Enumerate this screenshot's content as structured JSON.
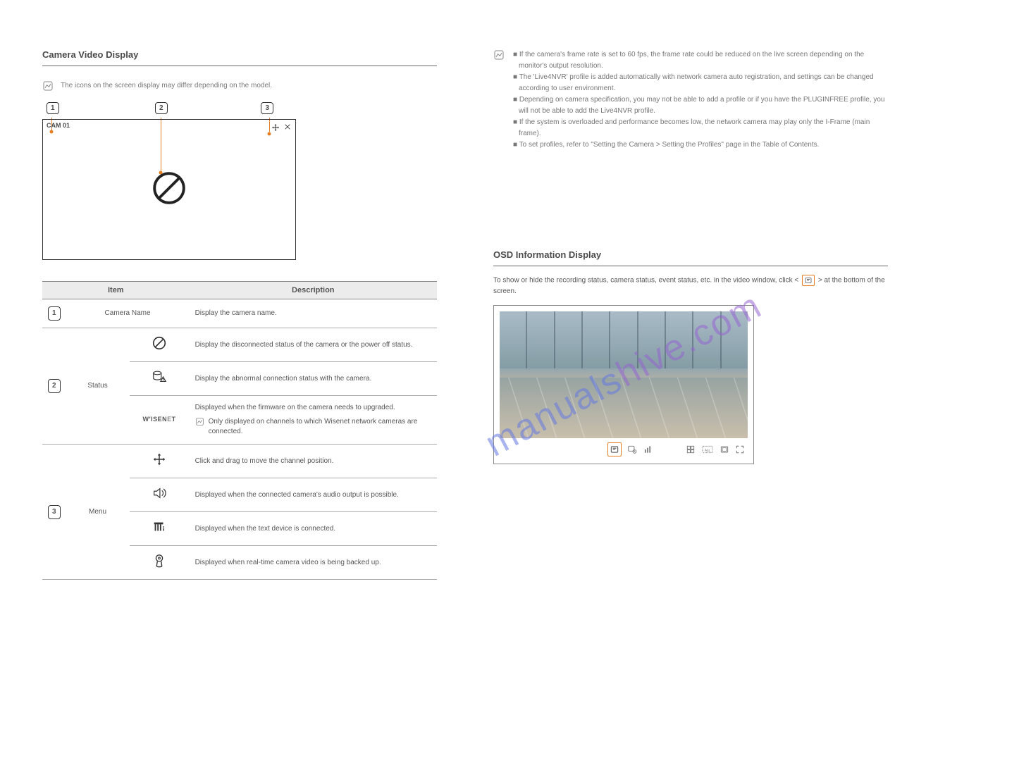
{
  "leftSection": {
    "title": "Camera Video Display",
    "note": "The icons on the screen display may differ depending on the model.",
    "diagram": {
      "cam_label": "CAM 01",
      "callouts": [
        "1",
        "2",
        "3"
      ]
    },
    "table": {
      "headers": {
        "item": "Item",
        "desc": "Description"
      },
      "rows": {
        "r1": {
          "num": "1",
          "label": "Camera Name",
          "desc": "Display the camera name."
        },
        "r2": {
          "num": "2",
          "label": "Status",
          "items": {
            "a": {
              "desc": "Display the disconnected status of the camera or the power off status."
            },
            "b": {
              "desc": "Display the abnormal connection status with the camera."
            },
            "c_main": "Displayed when the firmware on the camera needs to upgraded.",
            "c_note": "Only displayed on channels to which Wisenet network cameras are connected."
          }
        },
        "r3": {
          "num": "3",
          "label": "Menu",
          "items": {
            "a": {
              "desc": "Click and drag to move the channel position."
            },
            "b": {
              "desc": "Displayed when the connected camera's audio output is possible."
            },
            "c": {
              "desc": "Displayed when the text device is connected."
            },
            "d": {
              "desc": "Displayed when real-time camera video is being backed up."
            }
          }
        }
      }
    }
  },
  "rightSection": {
    "bullets": [
      "■  If the camera's frame rate is set to 60 fps, the frame rate could be reduced on the live screen depending on the monitor's output resolution.",
      "■  The 'Live4NVR' profile is added automatically with network camera auto registration, and settings can be changed according to user environment.",
      "■  Depending on camera specification, you may not be able to add a profile or if you have the PLUGINFREE profile, you will not be able to add the Live4NVR profile.",
      "■  If the system is overloaded and performance becomes low, the network camera may play only the I-Frame (main frame).",
      "■  To set profiles, refer to \"Setting the Camera > Setting the Profiles\" page in the Table of Contents."
    ],
    "osdTitle": "OSD Information Display",
    "osdBody": "To show or hide the recording status, camera status, event status, etc. in the video window, click <        > at the bottom of the screen."
  },
  "watermark": {
    "part1": "manuals",
    "part2": "hive.com"
  }
}
